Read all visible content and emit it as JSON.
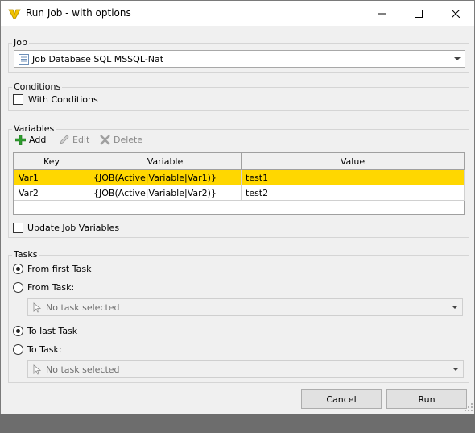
{
  "window": {
    "title": "Run Job - with options"
  },
  "job": {
    "group_label": "Job",
    "selected": "Job Database SQL MSSQL-Nat"
  },
  "conditions": {
    "group_label": "Conditions",
    "with_conditions_label": "With Conditions",
    "with_conditions_checked": false
  },
  "variables": {
    "group_label": "Variables",
    "toolbar": {
      "add": "Add",
      "edit": "Edit",
      "delete": "Delete"
    },
    "columns": [
      "Key",
      "Variable",
      "Value"
    ],
    "rows": [
      {
        "key": "Var1",
        "variable": "{JOB(Active|Variable|Var1)}",
        "value": "test1",
        "selected": true
      },
      {
        "key": "Var2",
        "variable": "{JOB(Active|Variable|Var2)}",
        "value": "test2",
        "selected": false
      }
    ],
    "update_label": "Update Job Variables",
    "update_checked": false
  },
  "tasks": {
    "group_label": "Tasks",
    "from_first_label": "From first Task",
    "from_task_label": "From Task:",
    "from_task_placeholder": "No task selected",
    "to_last_label": "To last Task",
    "to_task_label": "To Task:",
    "to_task_placeholder": "No task selected",
    "from_selected": "first",
    "to_selected": "last"
  },
  "buttons": {
    "cancel": "Cancel",
    "run": "Run"
  },
  "colors": {
    "selection": "#ffd700",
    "add_icon": "#2e9e2e",
    "app_icon": "#f2c200"
  }
}
